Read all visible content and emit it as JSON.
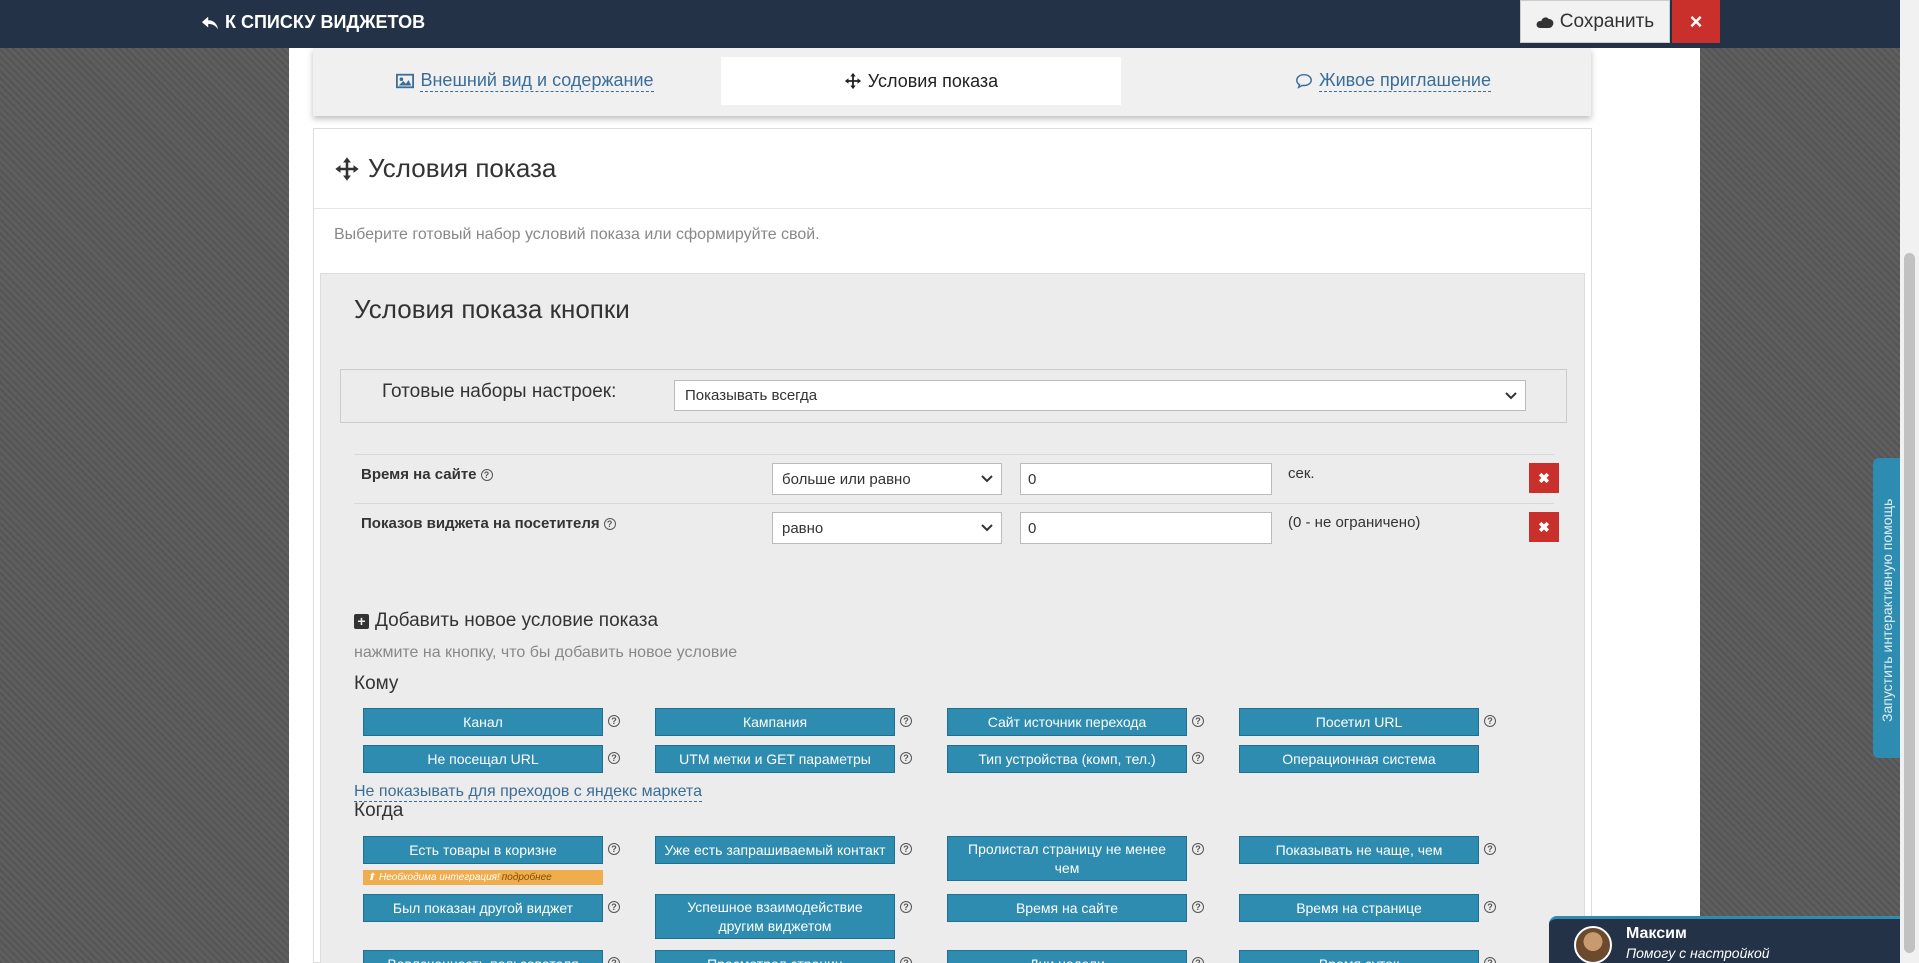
{
  "header": {
    "back_label": "К СПИСКУ ВИДЖЕТОВ",
    "save_label": "Сохранить",
    "close_icon": "×"
  },
  "tabs": [
    {
      "label": "Внешний вид и содержание",
      "icon": "image-icon",
      "active": false
    },
    {
      "label": "Условия показа",
      "icon": "crosshair-icon",
      "active": true
    },
    {
      "label": "Живое приглашение",
      "icon": "chat-icon",
      "active": false
    }
  ],
  "panel": {
    "title": "Условия показа",
    "description": "Выберите готовый набор условий показа или сформируйте свой."
  },
  "conditions_box": {
    "title": "Условия показа кнопки",
    "preset_label": "Готовые наборы настроек:",
    "preset_value": "Показывать всегда",
    "rows": [
      {
        "label": "Время на сайте",
        "operator": "больше или равно",
        "value": "0",
        "unit": "сек."
      },
      {
        "label": "Показов виджета на посетителя",
        "operator": "равно",
        "value": "0",
        "unit": "(0 - не ограничено)"
      }
    ]
  },
  "add_section": {
    "title": "Добавить новое условие показа",
    "hint": "нажмите на кнопку, что бы добавить новое условие"
  },
  "groups": {
    "who": {
      "title": "Кому",
      "buttons": [
        "Канал",
        "Кампания",
        "Сайт источник перехода",
        "Посетил URL",
        "Не посещал URL",
        "UTM метки и GET параметры",
        "Тип устройства (комп, тел.)",
        "Операционная система"
      ],
      "link": "Не показывать для преходов с яндекс маркета"
    },
    "when": {
      "title": "Когда",
      "buttons": [
        "Есть товары в коризне",
        "Уже есть запрашиваемый контакт",
        "Пролистал страницу не менее чем",
        "Показывать не чаще, чем",
        "Был показан другой виджет",
        "Успешное взаимодействие другим виджетом",
        "Время на сайте",
        "Время на странице",
        "Вовлеченность пользователя",
        "Просмотрел страниц",
        "Дни недели",
        "Время суток"
      ],
      "integration_note": "Необходима интеграция!",
      "integration_more": "подробнее"
    }
  },
  "side_tab": {
    "label": "Запустить интерактивную помощь"
  },
  "chat": {
    "name": "Максим",
    "subtitle": "Помогу с настройкой"
  },
  "colors": {
    "topbar": "#233246",
    "accent": "#2d8cb0",
    "danger": "#c9302c",
    "warning": "#f0ad4e"
  }
}
